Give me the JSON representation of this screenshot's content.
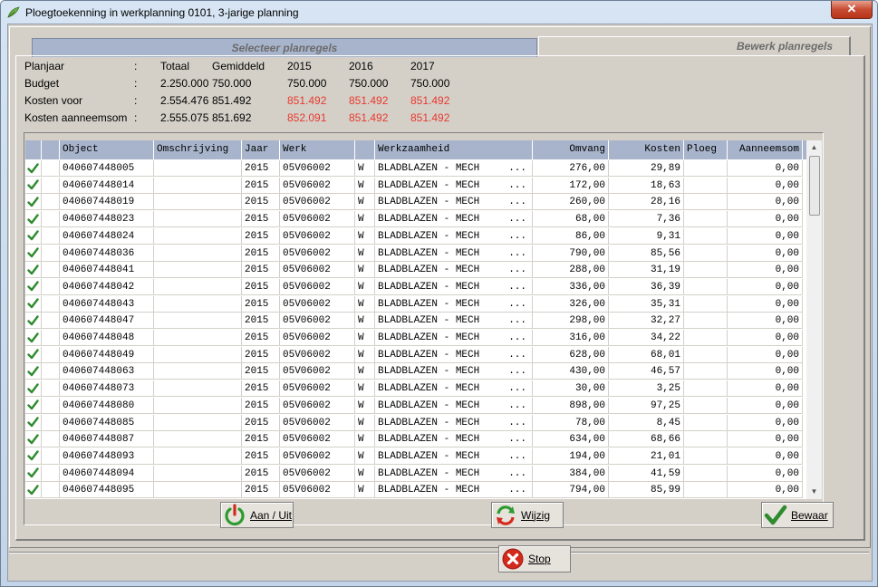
{
  "window": {
    "title": "Ploegtoekenning in werkplanning 0101, 3-jarige planning",
    "close_label": "✕"
  },
  "tabs": [
    {
      "label": "Selecteer planregels"
    },
    {
      "label": "Bewerk planregels"
    }
  ],
  "summary": {
    "headers": {
      "label": "Planjaar",
      "sep": ":",
      "totaal": "Totaal",
      "gemiddeld": "Gemiddeld",
      "y1": "2015",
      "y2": "2016",
      "y3": "2017"
    },
    "rows": [
      {
        "label": "Budget",
        "sep": ":",
        "totaal": "2.250.000",
        "gemiddeld": "750.000",
        "y1": "750.000",
        "y2": "750.000",
        "y3": "750.000",
        "red": false
      },
      {
        "label": "Kosten voor",
        "sep": ":",
        "totaal": "2.554.476",
        "gemiddeld": "851.492",
        "y1": "851.492",
        "y2": "851.492",
        "y3": "851.492",
        "red": true
      },
      {
        "label": "Kosten aanneemsom",
        "sep": ":",
        "totaal": "2.555.075",
        "gemiddeld": "851.692",
        "y1": "852.091",
        "y2": "851.492",
        "y3": "851.492",
        "red": true
      }
    ]
  },
  "grid": {
    "columns": [
      "",
      "",
      "Object",
      "Omschrijving",
      "Jaar",
      "Werk",
      "",
      "Werkzaamheid",
      "Omvang",
      "Kosten",
      "Ploeg",
      "Aanneemsom"
    ],
    "rows": [
      {
        "object": "040607448005",
        "jaar": "2015",
        "werk": "05V06002",
        "w": "W",
        "werkzaamheid": "BLADBLAZEN - MECH",
        "dots": "...",
        "omvang": "276,00",
        "kosten": "29,89",
        "ploeg": "",
        "aanneemsom": "0,00"
      },
      {
        "object": "040607448014",
        "jaar": "2015",
        "werk": "05V06002",
        "w": "W",
        "werkzaamheid": "BLADBLAZEN - MECH",
        "dots": "...",
        "omvang": "172,00",
        "kosten": "18,63",
        "ploeg": "",
        "aanneemsom": "0,00"
      },
      {
        "object": "040607448019",
        "jaar": "2015",
        "werk": "05V06002",
        "w": "W",
        "werkzaamheid": "BLADBLAZEN - MECH",
        "dots": "...",
        "omvang": "260,00",
        "kosten": "28,16",
        "ploeg": "",
        "aanneemsom": "0,00"
      },
      {
        "object": "040607448023",
        "jaar": "2015",
        "werk": "05V06002",
        "w": "W",
        "werkzaamheid": "BLADBLAZEN - MECH",
        "dots": "...",
        "omvang": "68,00",
        "kosten": "7,36",
        "ploeg": "",
        "aanneemsom": "0,00"
      },
      {
        "object": "040607448024",
        "jaar": "2015",
        "werk": "05V06002",
        "w": "W",
        "werkzaamheid": "BLADBLAZEN - MECH",
        "dots": "...",
        "omvang": "86,00",
        "kosten": "9,31",
        "ploeg": "",
        "aanneemsom": "0,00"
      },
      {
        "object": "040607448036",
        "jaar": "2015",
        "werk": "05V06002",
        "w": "W",
        "werkzaamheid": "BLADBLAZEN - MECH",
        "dots": "...",
        "omvang": "790,00",
        "kosten": "85,56",
        "ploeg": "",
        "aanneemsom": "0,00"
      },
      {
        "object": "040607448041",
        "jaar": "2015",
        "werk": "05V06002",
        "w": "W",
        "werkzaamheid": "BLADBLAZEN - MECH",
        "dots": "...",
        "omvang": "288,00",
        "kosten": "31,19",
        "ploeg": "",
        "aanneemsom": "0,00"
      },
      {
        "object": "040607448042",
        "jaar": "2015",
        "werk": "05V06002",
        "w": "W",
        "werkzaamheid": "BLADBLAZEN - MECH",
        "dots": "...",
        "omvang": "336,00",
        "kosten": "36,39",
        "ploeg": "",
        "aanneemsom": "0,00"
      },
      {
        "object": "040607448043",
        "jaar": "2015",
        "werk": "05V06002",
        "w": "W",
        "werkzaamheid": "BLADBLAZEN - MECH",
        "dots": "...",
        "omvang": "326,00",
        "kosten": "35,31",
        "ploeg": "",
        "aanneemsom": "0,00"
      },
      {
        "object": "040607448047",
        "jaar": "2015",
        "werk": "05V06002",
        "w": "W",
        "werkzaamheid": "BLADBLAZEN - MECH",
        "dots": "...",
        "omvang": "298,00",
        "kosten": "32,27",
        "ploeg": "",
        "aanneemsom": "0,00"
      },
      {
        "object": "040607448048",
        "jaar": "2015",
        "werk": "05V06002",
        "w": "W",
        "werkzaamheid": "BLADBLAZEN - MECH",
        "dots": "...",
        "omvang": "316,00",
        "kosten": "34,22",
        "ploeg": "",
        "aanneemsom": "0,00"
      },
      {
        "object": "040607448049",
        "jaar": "2015",
        "werk": "05V06002",
        "w": "W",
        "werkzaamheid": "BLADBLAZEN - MECH",
        "dots": "...",
        "omvang": "628,00",
        "kosten": "68,01",
        "ploeg": "",
        "aanneemsom": "0,00"
      },
      {
        "object": "040607448063",
        "jaar": "2015",
        "werk": "05V06002",
        "w": "W",
        "werkzaamheid": "BLADBLAZEN - MECH",
        "dots": "...",
        "omvang": "430,00",
        "kosten": "46,57",
        "ploeg": "",
        "aanneemsom": "0,00"
      },
      {
        "object": "040607448073",
        "jaar": "2015",
        "werk": "05V06002",
        "w": "W",
        "werkzaamheid": "BLADBLAZEN - MECH",
        "dots": "...",
        "omvang": "30,00",
        "kosten": "3,25",
        "ploeg": "",
        "aanneemsom": "0,00"
      },
      {
        "object": "040607448080",
        "jaar": "2015",
        "werk": "05V06002",
        "w": "W",
        "werkzaamheid": "BLADBLAZEN - MECH",
        "dots": "...",
        "omvang": "898,00",
        "kosten": "97,25",
        "ploeg": "",
        "aanneemsom": "0,00"
      },
      {
        "object": "040607448085",
        "jaar": "2015",
        "werk": "05V06002",
        "w": "W",
        "werkzaamheid": "BLADBLAZEN - MECH",
        "dots": "...",
        "omvang": "78,00",
        "kosten": "8,45",
        "ploeg": "",
        "aanneemsom": "0,00"
      },
      {
        "object": "040607448087",
        "jaar": "2015",
        "werk": "05V06002",
        "w": "W",
        "werkzaamheid": "BLADBLAZEN - MECH",
        "dots": "...",
        "omvang": "634,00",
        "kosten": "68,66",
        "ploeg": "",
        "aanneemsom": "0,00"
      },
      {
        "object": "040607448093",
        "jaar": "2015",
        "werk": "05V06002",
        "w": "W",
        "werkzaamheid": "BLADBLAZEN - MECH",
        "dots": "...",
        "omvang": "194,00",
        "kosten": "21,01",
        "ploeg": "",
        "aanneemsom": "0,00"
      },
      {
        "object": "040607448094",
        "jaar": "2015",
        "werk": "05V06002",
        "w": "W",
        "werkzaamheid": "BLADBLAZEN - MECH",
        "dots": "...",
        "omvang": "384,00",
        "kosten": "41,59",
        "ploeg": "",
        "aanneemsom": "0,00"
      },
      {
        "object": "040607448095",
        "jaar": "2015",
        "werk": "05V06002",
        "w": "W",
        "werkzaamheid": "BLADBLAZEN - MECH",
        "dots": "...",
        "omvang": "794,00",
        "kosten": "85,99",
        "ploeg": "",
        "aanneemsom": "0,00"
      }
    ]
  },
  "buttons": {
    "aan_uit": {
      "label": "Aan / Uit",
      "icon": "power-icon"
    },
    "wijzig": {
      "label": "Wijzig",
      "icon": "refresh-icon"
    },
    "bewaar": {
      "label": "Bewaar",
      "icon": "checkmark-icon"
    },
    "stop": {
      "label": "Stop",
      "icon": "stop-icon"
    }
  },
  "colors": {
    "header_bg": "#a7b4cb",
    "red_value": "#e8382e",
    "check_green": "#2e8b2e"
  }
}
